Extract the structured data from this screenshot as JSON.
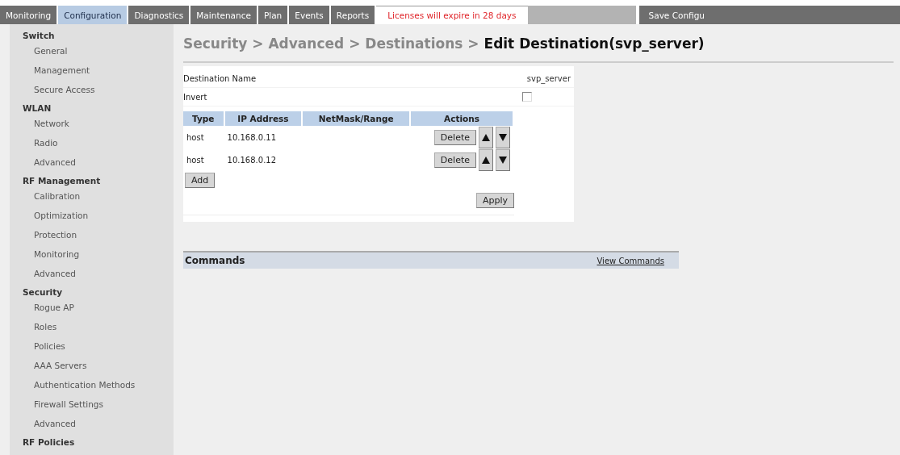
{
  "tabs": [
    {
      "label": "Monitoring",
      "selected": false
    },
    {
      "label": "Configuration",
      "selected": true
    },
    {
      "label": "Diagnostics",
      "selected": false
    },
    {
      "label": "Maintenance",
      "selected": false
    },
    {
      "label": "Plan",
      "selected": false
    },
    {
      "label": "Events",
      "selected": false
    },
    {
      "label": "Reports",
      "selected": false
    }
  ],
  "license_notice": "Licenses will expire in 28 days",
  "save_button": "Save Configu",
  "sidebar": {
    "sections": [
      {
        "title": "Switch",
        "items": [
          {
            "label": "General"
          },
          {
            "label": "Management"
          },
          {
            "label": "Secure Access"
          }
        ]
      },
      {
        "title": "WLAN",
        "items": [
          {
            "label": "Network"
          },
          {
            "label": "Radio"
          },
          {
            "label": "Advanced"
          }
        ]
      },
      {
        "title": "RF Management",
        "items": [
          {
            "label": "Calibration"
          },
          {
            "label": "Optimization"
          },
          {
            "label": "Protection"
          },
          {
            "label": "Monitoring"
          },
          {
            "label": "Advanced"
          }
        ]
      },
      {
        "title": "Security",
        "items": [
          {
            "label": "Rogue AP"
          },
          {
            "label": "Roles"
          },
          {
            "label": "Policies"
          },
          {
            "label": "AAA Servers"
          },
          {
            "label": "Authentication Methods"
          },
          {
            "label": "Firewall Settings"
          },
          {
            "label": "Advanced"
          }
        ]
      },
      {
        "title": "RF Policies"
      }
    ]
  },
  "breadcrumb": "Security > Advanced > Destinations > **Edit Destination(svp_server)**",
  "form": {
    "name_label": "Destination Name",
    "name_value": "svp_server",
    "invert_label": "Invert",
    "invert_checked": false
  },
  "table": {
    "columns": [
      "Type",
      "IP Address",
      "NetMask/Range",
      "Actions"
    ],
    "rows": [
      {
        "type": "host",
        "ip": "10.168.0.11",
        "delete": "Delete"
      },
      {
        "type": "host",
        "ip": "10.168.0.12",
        "delete": "Delete"
      }
    ]
  },
  "add_button": "Add",
  "apply_button": "Apply",
  "commands": {
    "title": "Commands",
    "link": "View Commands"
  }
}
